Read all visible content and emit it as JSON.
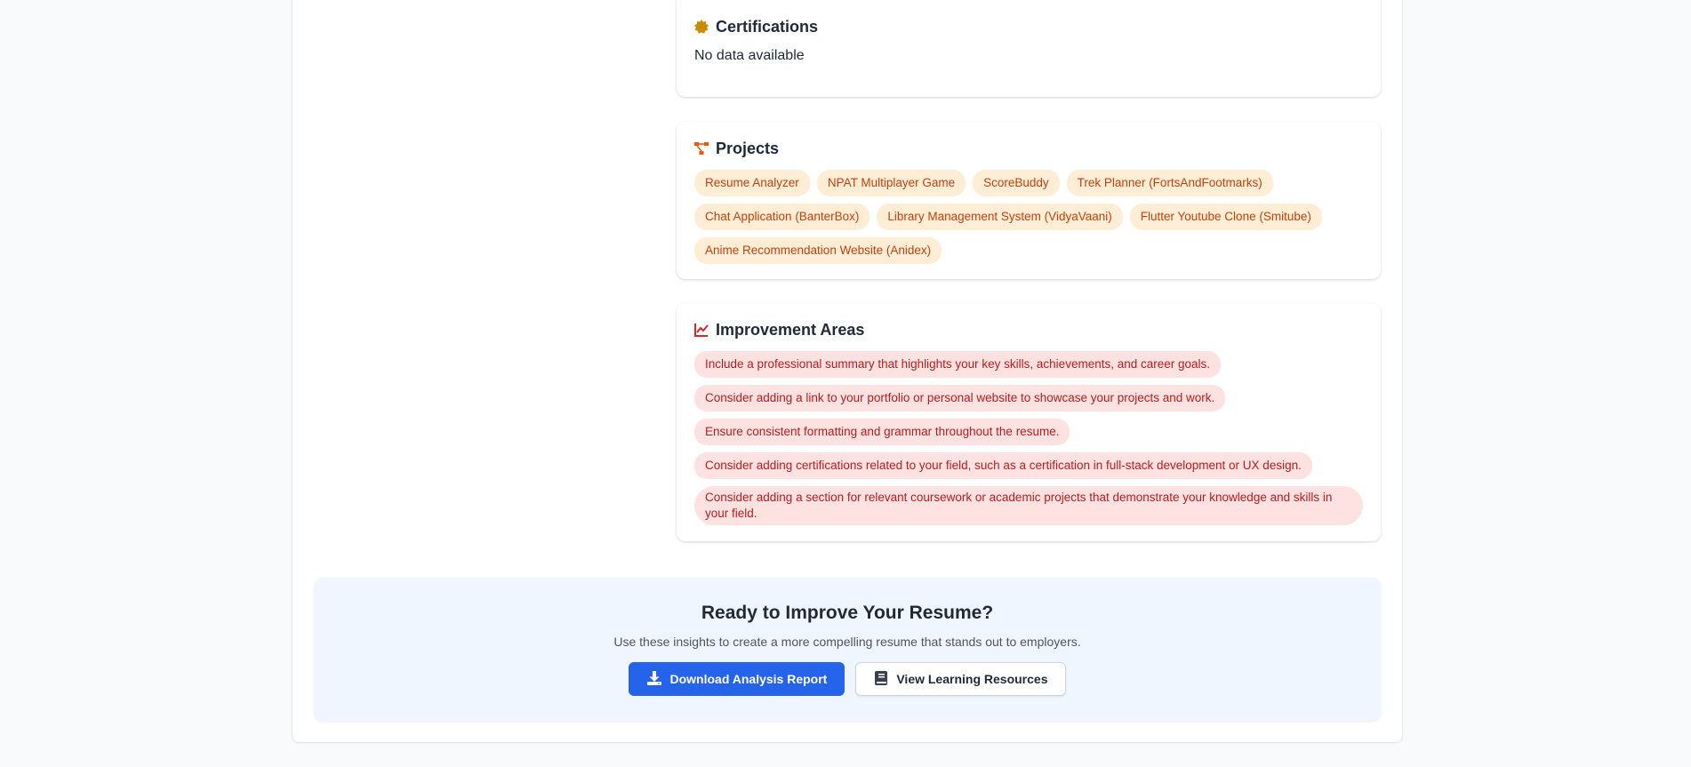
{
  "certifications": {
    "title": "Certifications",
    "text": "No data available",
    "icon": "badge-icon",
    "icon_color": "#ca8a04"
  },
  "projects": {
    "title": "Projects",
    "icon": "project-diagram-icon",
    "icon_color": "#ea580c",
    "items": [
      "Resume Analyzer",
      "NPAT Multiplayer Game",
      "ScoreBuddy",
      "Trek Planner (FortsAndFootmarks)",
      "Chat Application (BanterBox)",
      "Library Management System (VidyaVaani)",
      "Flutter Youtube Clone (Smitube)",
      "Anime Recommendation Website (Anidex)"
    ]
  },
  "improvement": {
    "title": "Improvement Areas",
    "icon": "chart-line-icon",
    "icon_color": "#dc2626",
    "items": [
      "Include a professional summary that highlights your key skills, achievements, and career goals.",
      "Consider adding a link to your portfolio or personal website to showcase your projects and work.",
      "Ensure consistent formatting and grammar throughout the resume.",
      "Consider adding certifications related to your field, such as a certification in full-stack development or UX design.",
      "Consider adding a section for relevant coursework or academic projects that demonstrate your knowledge and skills in your field."
    ]
  },
  "cta": {
    "title": "Ready to Improve Your Resume?",
    "subtitle": "Use these insights to create a more compelling resume that stands out to employers.",
    "download_label": "Download Analysis Report",
    "resources_label": "View Learning Resources",
    "primary_color": "#2563eb"
  }
}
